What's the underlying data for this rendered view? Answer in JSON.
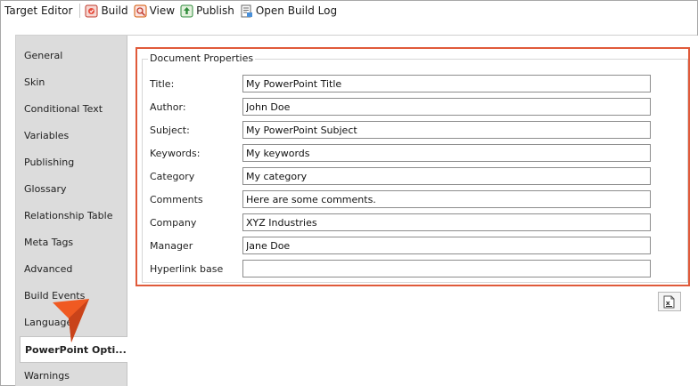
{
  "toolbar": {
    "title": "Target Editor",
    "buttons": [
      {
        "label": "Build",
        "icon": "build-icon"
      },
      {
        "label": "View",
        "icon": "view-icon"
      },
      {
        "label": "Publish",
        "icon": "publish-icon"
      },
      {
        "label": "Open Build Log",
        "icon": "build-log-icon"
      }
    ]
  },
  "tabs": [
    {
      "label": "General"
    },
    {
      "label": "Skin"
    },
    {
      "label": "Conditional Text"
    },
    {
      "label": "Variables"
    },
    {
      "label": "Publishing"
    },
    {
      "label": "Glossary"
    },
    {
      "label": "Relationship Table"
    },
    {
      "label": "Meta Tags"
    },
    {
      "label": "Advanced"
    },
    {
      "label": "Build Events"
    },
    {
      "label": "Language"
    },
    {
      "label": "PowerPoint Opti..."
    },
    {
      "label": "Warnings"
    }
  ],
  "active_tab": "PowerPoint Opti...",
  "document_properties": {
    "title": "Document Properties",
    "fields": [
      {
        "label": "Title:",
        "value": "My PowerPoint Title"
      },
      {
        "label": "Author:",
        "value": "John Doe"
      },
      {
        "label": "Subject:",
        "value": "My PowerPoint Subject"
      },
      {
        "label": "Keywords:",
        "value": "My keywords"
      },
      {
        "label": "Category",
        "value": "My category"
      },
      {
        "label": "Comments",
        "value": "Here are some comments."
      },
      {
        "label": "Company",
        "value": "XYZ Industries"
      },
      {
        "label": "Manager",
        "value": "Jane Doe"
      },
      {
        "label": "Hyperlink base",
        "value": ""
      }
    ]
  },
  "colors": {
    "highlight_border": "#e05a3a",
    "pointer_arrow": "#f05a22"
  }
}
